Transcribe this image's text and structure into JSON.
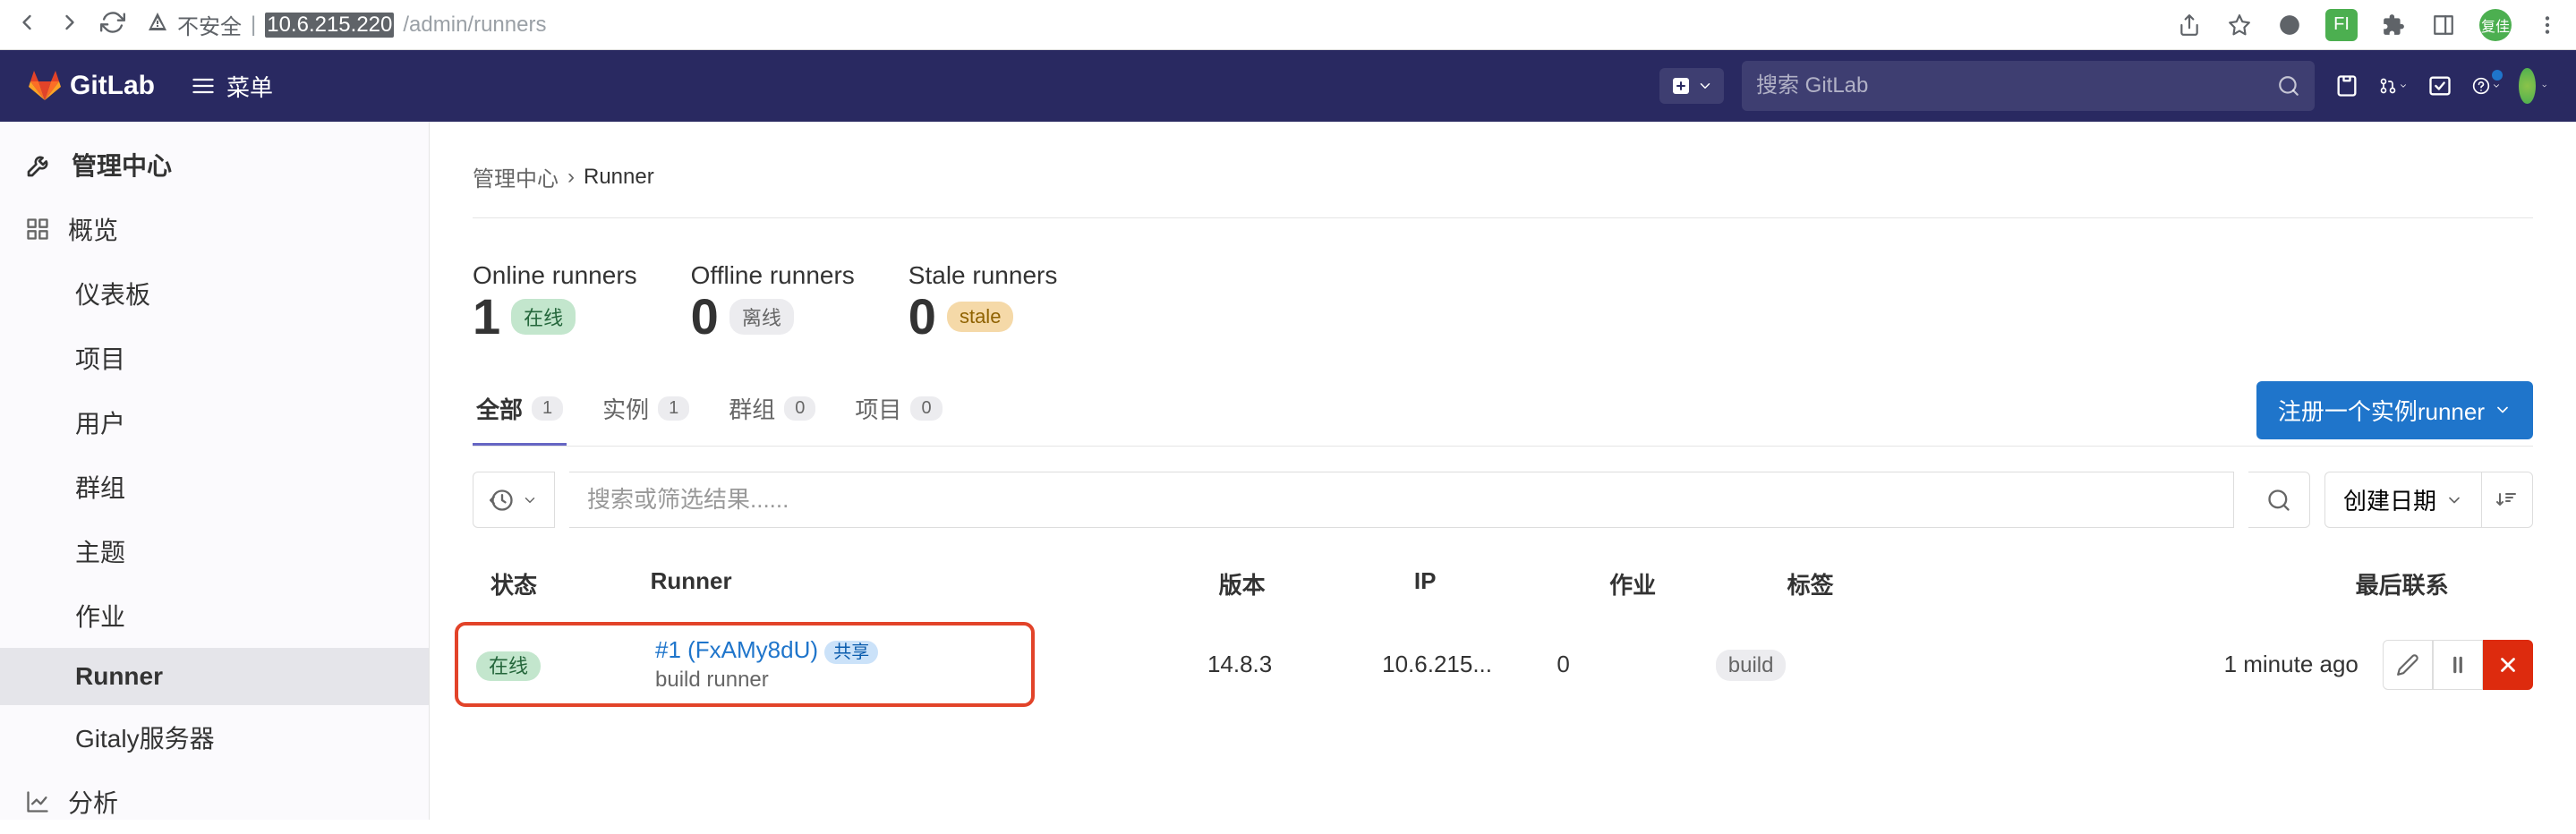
{
  "browser": {
    "insecure_label": "不安全",
    "url_host": "10.6.215.220",
    "url_path": "/admin/runners",
    "ext_fi": "FI",
    "avatar": "复佳"
  },
  "topbar": {
    "brand": "GitLab",
    "menu": "菜单",
    "search_placeholder": "搜索 GitLab"
  },
  "sidebar": {
    "admin_title": "管理中心",
    "overview": "概览",
    "items": [
      "仪表板",
      "项目",
      "用户",
      "群组",
      "主题",
      "作业",
      "Runner",
      "Gitaly服务器"
    ],
    "analytics": "分析"
  },
  "breadcrumb": {
    "root": "管理中心",
    "sep": "›",
    "current": "Runner"
  },
  "stats": {
    "online": {
      "label": "Online runners",
      "value": "1",
      "badge": "在线"
    },
    "offline": {
      "label": "Offline runners",
      "value": "0",
      "badge": "离线"
    },
    "stale": {
      "label": "Stale runners",
      "value": "0",
      "badge": "stale"
    }
  },
  "tabs": {
    "all": {
      "label": "全部",
      "count": "1"
    },
    "instance": {
      "label": "实例",
      "count": "1"
    },
    "group": {
      "label": "群组",
      "count": "0"
    },
    "project": {
      "label": "项目",
      "count": "0"
    }
  },
  "register_btn": "注册一个实例runner",
  "filter": {
    "placeholder": "搜索或筛选结果......",
    "sort": "创建日期"
  },
  "table": {
    "headers": {
      "status": "状态",
      "runner": "Runner",
      "version": "版本",
      "ip": "IP",
      "jobs": "作业",
      "tags": "标签",
      "contact": "最后联系"
    },
    "rows": [
      {
        "status": "在线",
        "runner_id": "#1 (FxAMy8dU)",
        "share_badge": "共享",
        "description": "build runner",
        "version": "14.8.3",
        "ip": "10.6.215...",
        "jobs": "0",
        "tag": "build",
        "contact": "1 minute ago"
      }
    ]
  }
}
